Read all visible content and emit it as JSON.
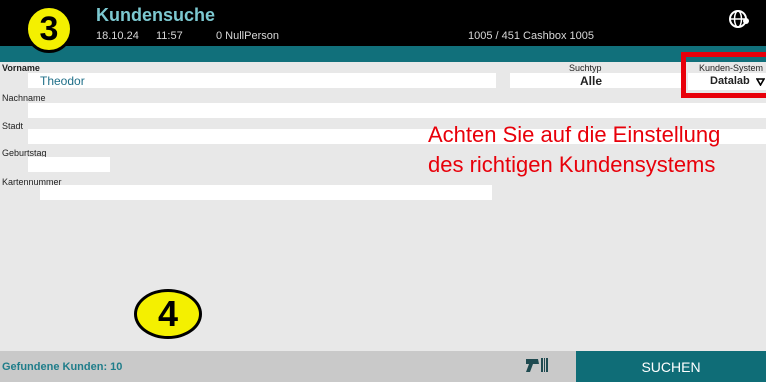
{
  "header": {
    "title": "Kundensuche",
    "date": "18.10.24",
    "time": "11:57",
    "person": "0 NullPerson",
    "cashbox": "1005 / 451 Cashbox 1005"
  },
  "annotations": {
    "step_top": "3",
    "step_bottom": "4",
    "callout": "Achten Sie auf die Einstellung des richtigen Kundensystems"
  },
  "form": {
    "vorname_label": "Vorname",
    "vorname_value": "Theodor",
    "nachname_label": "Nachname",
    "stadt_label": "Stadt",
    "geburtstag_label": "Geburtstag",
    "kartennummer_label": "Kartennummer",
    "suchtyp_label": "Suchtyp",
    "suchtyp_value": "Alle",
    "kundensystem_label": "Kunden-System",
    "kundensystem_value": "Datalab"
  },
  "footer": {
    "status": "Gefundene Kunden: 10",
    "search_label": "SUCHEN"
  },
  "colors": {
    "accent": "#0f6d77",
    "highlight": "#e8000a",
    "badge": "#f4f000"
  }
}
